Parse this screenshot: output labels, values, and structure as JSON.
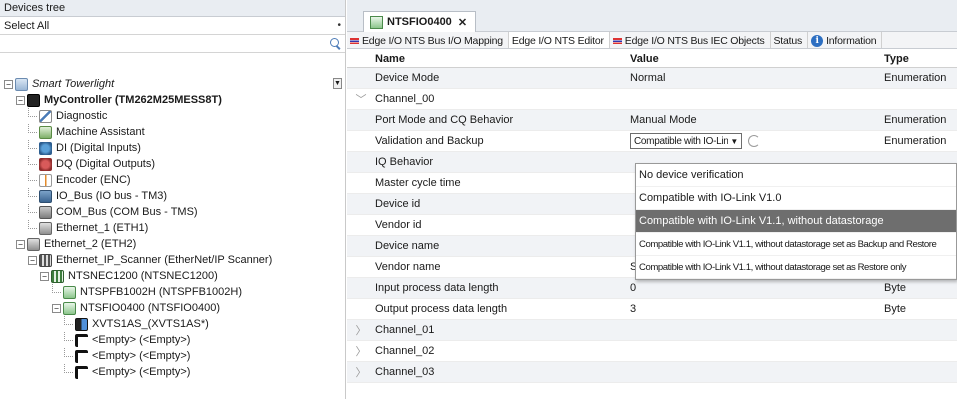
{
  "devices_tree": {
    "header": "Devices tree",
    "select_value": "Select All",
    "nodes": [
      {
        "label": "Smart Towerlight",
        "style": "italic",
        "indent": 0,
        "expander": "minus",
        "icon": "project-icon"
      },
      {
        "label": "MyController (TM262M25MESS8T)",
        "style": "bold",
        "indent": 1,
        "expander": "minus",
        "icon": "controller-icon"
      },
      {
        "label": "Diagnostic",
        "indent": 2,
        "expander": "none",
        "icon": "diagnostic-icon"
      },
      {
        "label": "Machine Assistant",
        "indent": 2,
        "expander": "none",
        "icon": "assistant-icon"
      },
      {
        "label": "DI (Digital Inputs)",
        "indent": 2,
        "expander": "none",
        "icon": "digital-input-icon"
      },
      {
        "label": "DQ (Digital Outputs)",
        "indent": 2,
        "expander": "none",
        "icon": "digital-output-icon"
      },
      {
        "label": "Encoder (ENC)",
        "indent": 2,
        "expander": "none",
        "icon": "encoder-icon"
      },
      {
        "label": "IO_Bus (IO bus - TM3)",
        "indent": 2,
        "expander": "none",
        "icon": "io-bus-icon"
      },
      {
        "label": "COM_Bus (COM Bus - TMS)",
        "indent": 2,
        "expander": "none",
        "icon": "com-bus-icon"
      },
      {
        "label": "Ethernet_1 (ETH1)",
        "indent": 2,
        "expander": "none",
        "icon": "ethernet-icon"
      },
      {
        "label": "Ethernet_2 (ETH2)",
        "indent": 1,
        "expander": "minus",
        "icon": "ethernet-icon"
      },
      {
        "label": "Ethernet_IP_Scanner (EtherNet/IP Scanner)",
        "indent": 2,
        "expander": "minus",
        "icon": "scanner-icon"
      },
      {
        "label": "NTSNEC1200 (NTSNEC1200)",
        "indent": 3,
        "expander": "minus",
        "icon": "module-icon"
      },
      {
        "label": "NTSPFB1002H (NTSPFB1002H)",
        "indent": 4,
        "expander": "none",
        "icon": "module-green-icon"
      },
      {
        "label": "NTSFIO0400 (NTSFIO0400)",
        "indent": 4,
        "expander": "minus",
        "icon": "module-green-icon"
      },
      {
        "label": "XVTS1AS_(XVTS1AS*)",
        "indent": 5,
        "expander": "none",
        "icon": "sensor-icon"
      },
      {
        "label": "<Empty> (<Empty>)",
        "indent": 5,
        "expander": "none",
        "icon": "empty-slot-icon"
      },
      {
        "label": "<Empty> (<Empty>)",
        "indent": 5,
        "expander": "none",
        "icon": "empty-slot-icon"
      },
      {
        "label": "<Empty> (<Empty>)",
        "indent": 5,
        "expander": "none",
        "icon": "empty-slot-icon"
      }
    ]
  },
  "editor": {
    "doc_tab_title": "NTSFIO0400",
    "sub_tabs": [
      {
        "label": "Edge I/O NTS Bus I/O Mapping",
        "icon": "flag-icon",
        "active": false
      },
      {
        "label": "Edge I/O NTS Editor",
        "icon": "",
        "active": true
      },
      {
        "label": "Edge I/O NTS Bus IEC Objects",
        "icon": "flag-icon",
        "active": false
      },
      {
        "label": "Status",
        "icon": "",
        "active": false
      },
      {
        "label": "Information",
        "icon": "info-icon",
        "active": false
      }
    ],
    "columns": {
      "name": "Name",
      "value": "Value",
      "type": "Type"
    },
    "rows": [
      {
        "expander": "",
        "name": "Device Mode",
        "value": "Normal",
        "type": "Enumeration"
      },
      {
        "expander": "﹀",
        "name": "Channel_00",
        "value": "",
        "type": ""
      },
      {
        "expander": "",
        "name": "Port Mode and CQ Behavior",
        "value": "Manual Mode",
        "type": "Enumeration"
      },
      {
        "expander": "",
        "name": "Validation and Backup",
        "value": "Compatible with IO-Link V1.1, without datast",
        "type": "Enumeration",
        "combo": true
      },
      {
        "expander": "",
        "name": "IQ Behavior",
        "value": "",
        "type": ""
      },
      {
        "expander": "",
        "name": "Master cycle time",
        "value": "",
        "type": ""
      },
      {
        "expander": "",
        "name": "Device id",
        "value": "",
        "type": ""
      },
      {
        "expander": "",
        "name": "Vendor id",
        "value": "",
        "type": ""
      },
      {
        "expander": "",
        "name": "Device name",
        "value": "",
        "type": ""
      },
      {
        "expander": "",
        "name": "Vendor name",
        "value": "Schneider Electric",
        "type": "String"
      },
      {
        "expander": "",
        "name": "Input process data length",
        "value": "0",
        "type": "Byte"
      },
      {
        "expander": "",
        "name": "Output process data length",
        "value": "3",
        "type": "Byte"
      },
      {
        "expander": "〉",
        "name": "Channel_01",
        "value": "",
        "type": ""
      },
      {
        "expander": "〉",
        "name": "Channel_02",
        "value": "",
        "type": ""
      },
      {
        "expander": "〉",
        "name": "Channel_03",
        "value": "",
        "type": ""
      }
    ],
    "dropdown_options": [
      {
        "label": "No device verification",
        "selected": false,
        "small": false
      },
      {
        "label": "Compatible with IO-Link V1.0",
        "selected": false,
        "small": false
      },
      {
        "label": "Compatible with IO-Link V1.1, without datastorage",
        "selected": true,
        "small": false
      },
      {
        "label": "Compatible with IO-Link V1.1, without datastorage set as Backup and Restore",
        "selected": false,
        "small": true
      },
      {
        "label": "Compatible with IO-Link V1.1, without datastorage set as Restore only",
        "selected": false,
        "small": true
      }
    ]
  },
  "colors": {
    "panel_header": "#e9edf2",
    "selected_option": "#6e6e6e",
    "alt_row": "#f1f3f6"
  }
}
